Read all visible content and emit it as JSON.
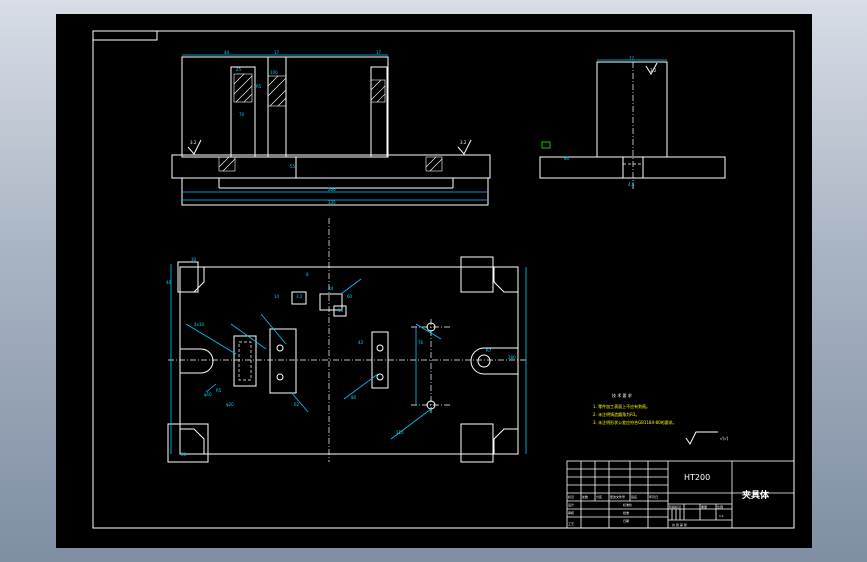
{
  "drawing": {
    "material": "HT200",
    "part_name": "夹具体",
    "scale": "1:1",
    "tech_requirements": {
      "title": "技 术 要 求",
      "items": [
        "1. 零件加工表面上不应有划痕。",
        "2. 未注明铸造圆角为R3。",
        "3. 未注明形状公差应符合GB1184-80的要求。"
      ]
    },
    "roughness_note": "√(√)",
    "title_block": {
      "row_labels": [
        "标记",
        "处数",
        "分区",
        "更改文件号",
        "签名",
        "年月日"
      ],
      "role_labels": [
        "设计",
        "审核",
        "工艺"
      ],
      "side_labels": [
        "标准化",
        "批准",
        "日期"
      ],
      "stage_labels": [
        "阶段标记",
        "重量",
        "比例"
      ],
      "sheet_label": "共 张 第 张"
    },
    "dimensions": {
      "front_view": [
        "40",
        "17",
        "25",
        "17",
        "R5",
        "70",
        "100",
        "55",
        "266",
        "335",
        "3.2",
        "3.2"
      ],
      "side_view": [
        "77",
        "3.2",
        "60",
        "4.5"
      ],
      "plan_view": [
        "30",
        "40",
        "8",
        "14",
        "3.2",
        "R4",
        "14",
        "60",
        "280",
        "4x10",
        "R5",
        "80",
        "110",
        "62",
        "φ10",
        "R7",
        "φ20",
        "76",
        "43",
        "30"
      ]
    }
  }
}
